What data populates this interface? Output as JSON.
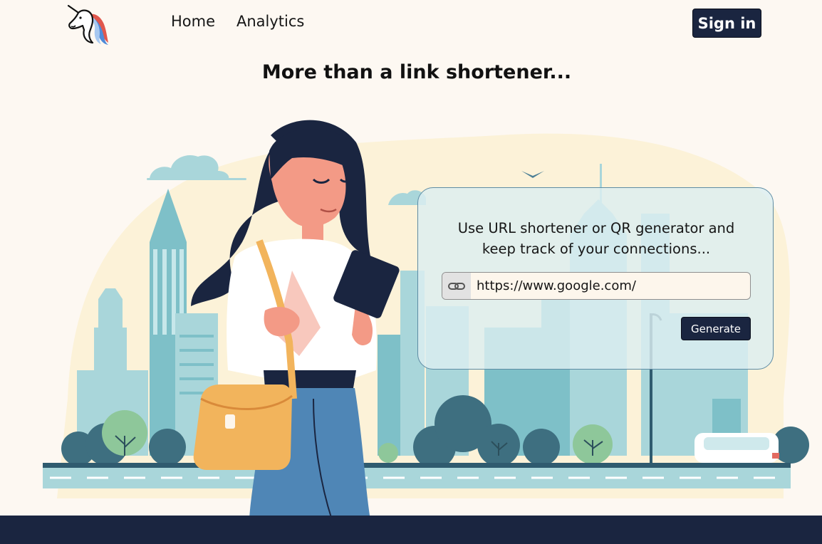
{
  "nav": {
    "logo_icon": "unicorn-logo-icon",
    "home": "Home",
    "analytics": "Analytics",
    "signin": "Sign in"
  },
  "hero": {
    "title": "More than a link shortener..."
  },
  "panel": {
    "line1": "Use URL shortener or QR generator and",
    "line2": "keep track of your connections...",
    "link_icon": "link-icon",
    "url_value": "https://www.google.com/",
    "generate_label": "Generate"
  },
  "colors": {
    "background": "#fdf8f2",
    "primary_dark": "#1a2540",
    "city_teal": "#a9d6da",
    "panel_border": "#5e8ca4"
  }
}
